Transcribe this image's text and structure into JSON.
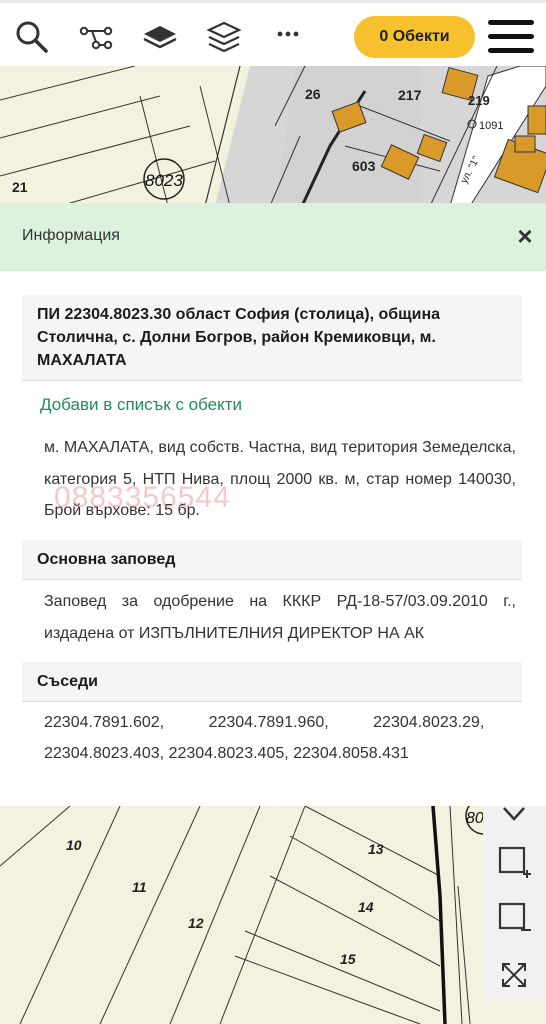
{
  "toolbar": {
    "objects_label": "0 Обекти",
    "icons": [
      "search-icon",
      "route-icon",
      "layer-icon",
      "layers-icon",
      "more-icon",
      "menu-icon"
    ]
  },
  "map_top": {
    "labels": [
      "26",
      "217",
      "219",
      "1091",
      "603",
      "21",
      "8023",
      "ул. \"1\""
    ]
  },
  "info": {
    "title": "Информация",
    "close": "×"
  },
  "property": {
    "heading": "ПИ 22304.8023.30 област София (столица), община Столична, с. Долни Богров, район Кремиковци, м. МАХАЛАТА",
    "add_link": "Добави в списък с обекти",
    "details": "м. МАХАЛАТА, вид собств. Частна, вид територия Земеделска, категория 5, НТП Нива, площ 2000 кв. м, стар номер 140030, Брой върхове: 15 бр.",
    "watermark": "0883356544"
  },
  "order": {
    "heading": "Основна заповед",
    "text": "Заповед за одобрение на КККР РД-18-57/03.09.2010 г., издадена от ИЗПЪЛНИТЕЛНИЯ ДИРЕКТОР НА АК"
  },
  "neighbors": {
    "heading": "Съседи",
    "line1": "22304.7891.602,          22304.7891.960,          22304.8023.29,",
    "line2": "22304.8023.403, 22304.8023.405, 22304.8058.431"
  },
  "map_bottom": {
    "labels": [
      "10",
      "11",
      "12",
      "13",
      "14",
      "15",
      "80"
    ]
  },
  "colors": {
    "accent": "#f7c12d",
    "link": "#1f8d54",
    "info_bg": "#dcf2dc",
    "building": "#d99a2a"
  }
}
